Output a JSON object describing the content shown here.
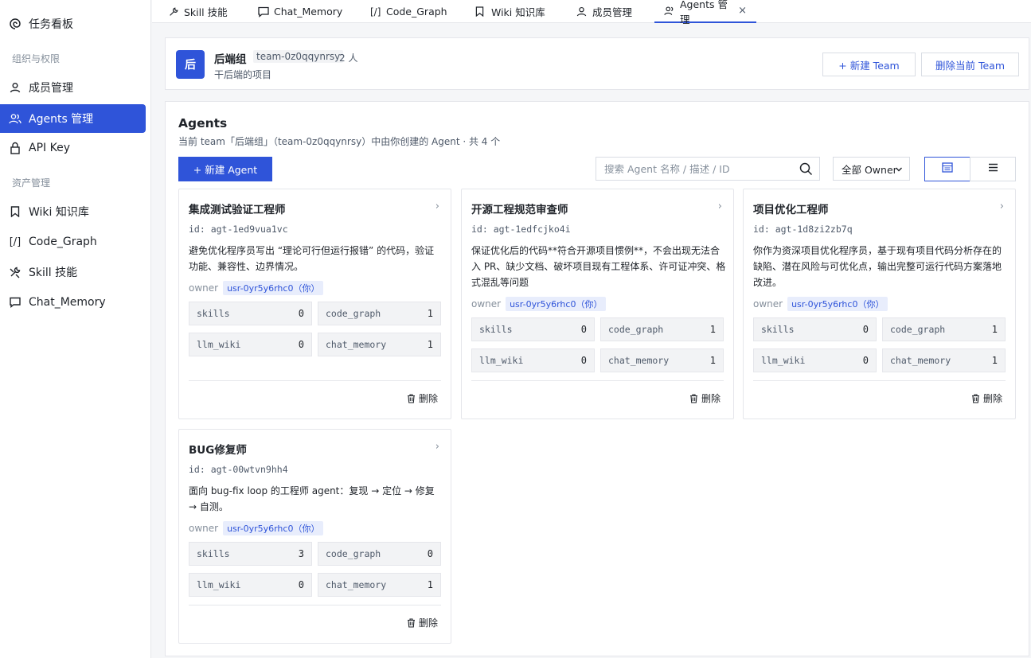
{
  "sidebar": {
    "top_item": "任务看板",
    "groups": [
      "组织与权限",
      "资产管理"
    ],
    "items": [
      {
        "label": "成员管理",
        "icon": "user-icon"
      },
      {
        "label": "Agents 管理",
        "icon": "users-icon",
        "active": true
      },
      {
        "label": "API Key",
        "icon": "lock-icon"
      },
      {
        "label": "Wiki 知识库",
        "icon": "bookmark-icon"
      },
      {
        "label": "Code_Graph",
        "icon": "code-icon"
      },
      {
        "label": "Skill 技能",
        "icon": "tools-icon"
      },
      {
        "label": "Chat_Memory",
        "icon": "chat-icon"
      }
    ]
  },
  "tabs": [
    {
      "label": "Skill 技能"
    },
    {
      "label": "Chat_Memory"
    },
    {
      "label": "Code_Graph"
    },
    {
      "label": "Wiki 知识库"
    },
    {
      "label": "成员管理"
    },
    {
      "label": "Agents 管理",
      "active": true,
      "close": "×"
    }
  ],
  "team": {
    "avatar": "后",
    "name": "后端组",
    "id": "team-0z0qqynrsy",
    "member_count": "2 人",
    "desc": "干后端的项目",
    "new_team_label": "+ 新建 Team",
    "delete_team_label": "删除当前 Team"
  },
  "panel": {
    "title": "Agents",
    "subtitle": "当前 team「后端组」（team-0z0qqynrsy）中由你创建的 Agent · 共 4 个",
    "new_agent_label": "+ 新建 Agent",
    "search_placeholder": "搜索 Agent 名称 / 描述 / ID",
    "owner_filter": "全部 Owner"
  },
  "agents": [
    {
      "name": "集成测试验证工程师",
      "id": "id: agt-1ed9vua1vc",
      "desc": "避免优化程序员写出 “理论可行但运行报错” 的代码，验证功能、兼容性、边界情况。",
      "owner_label": "owner",
      "owner": "usr-0yr5y6rhc0（你）",
      "stats": [
        {
          "key": "skills",
          "value": "0"
        },
        {
          "key": "code_graph",
          "value": "1"
        },
        {
          "key": "llm_wiki",
          "value": "0"
        },
        {
          "key": "chat_memory",
          "value": "1"
        }
      ],
      "delete_label": "删除"
    },
    {
      "name": "开源工程规范审查师",
      "id": "id: agt-1edfcjko4i",
      "desc": "保证优化后的代码**符合开源项目惯例**，不会出现无法合入 PR、缺少文档、破坏项目现有工程体系、许可证冲突、格式混乱等问题",
      "owner_label": "owner",
      "owner": "usr-0yr5y6rhc0（你）",
      "stats": [
        {
          "key": "skills",
          "value": "0"
        },
        {
          "key": "code_graph",
          "value": "1"
        },
        {
          "key": "llm_wiki",
          "value": "0"
        },
        {
          "key": "chat_memory",
          "value": "1"
        }
      ],
      "delete_label": "删除"
    },
    {
      "name": "项目优化工程师",
      "id": "id: agt-1d8zi2zb7q",
      "desc": "你作为资深项目优化程序员，基于现有项目代码分析存在的缺陷、潜在风险与可优化点，输出完整可运行代码方案落地改进。",
      "owner_label": "owner",
      "owner": "usr-0yr5y6rhc0（你）",
      "stats": [
        {
          "key": "skills",
          "value": "0"
        },
        {
          "key": "code_graph",
          "value": "1"
        },
        {
          "key": "llm_wiki",
          "value": "0"
        },
        {
          "key": "chat_memory",
          "value": "1"
        }
      ],
      "delete_label": "删除"
    },
    {
      "name": "BUG修复师",
      "id": "id: agt-00wtvn9hh4",
      "desc": "面向 bug-fix loop 的工程师 agent：复现 → 定位 → 修复 → 自测。",
      "owner_label": "owner",
      "owner": "usr-0yr5y6rhc0（你）",
      "stats": [
        {
          "key": "skills",
          "value": "3"
        },
        {
          "key": "code_graph",
          "value": "0"
        },
        {
          "key": "llm_wiki",
          "value": "0"
        },
        {
          "key": "chat_memory",
          "value": "1"
        }
      ],
      "delete_label": "删除"
    }
  ],
  "colors": {
    "accent": "#2f54d9",
    "owner_tag_bg": "#e8edfc",
    "border": "#e5e6eb"
  }
}
